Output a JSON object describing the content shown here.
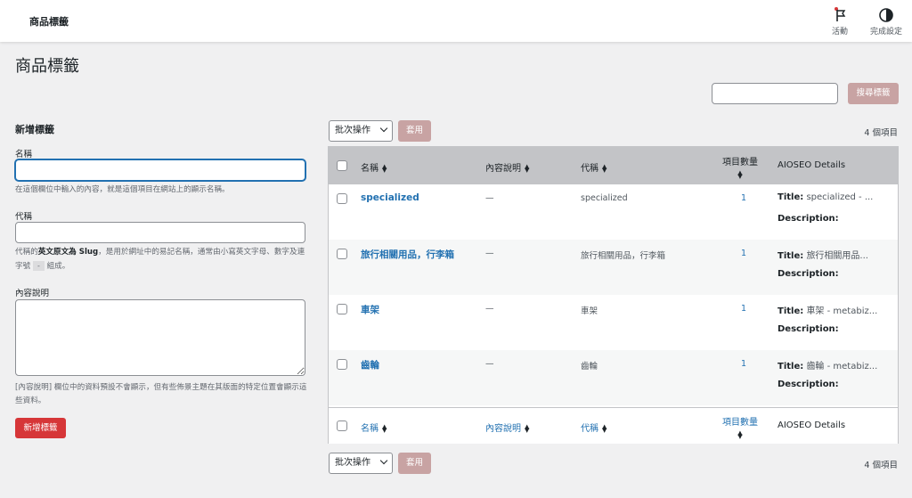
{
  "topbar": {
    "title": "商品標籤",
    "activity_label": "活動",
    "activity_icon": "flag-icon",
    "setup_label": "完成設定",
    "setup_icon": "half-circle-icon"
  },
  "page": {
    "title": "商品標籤"
  },
  "search": {
    "button_label": "搜尋標籤"
  },
  "add_form": {
    "heading": "新增標籤",
    "name_label": "名稱",
    "name_hint": "在這個欄位中輸入的內容，就是這個項目在網站上的顯示名稱。",
    "slug_label": "代稱",
    "slug_hint_1": "代稱的",
    "slug_hint_bold": "英文原文為 Slug",
    "slug_hint_2": "，是用於網址中的易記名稱，通常由小寫英文字母、數字及連字號",
    "slug_hint_code": "-",
    "slug_hint_3": "組成。",
    "desc_label": "內容說明",
    "desc_hint": "[內容說明] 欄位中的資料預設不會顯示，但有些佈景主題在其版面的特定位置會顯示這些資料。",
    "submit_label": "新增標籤"
  },
  "toolbar_top": {
    "bulk_label": "批次操作",
    "apply_label": "套用",
    "count": "4 個項目"
  },
  "toolbar_bottom": {
    "bulk_label": "批次操作",
    "apply_label": "套用",
    "count": "4 個項目"
  },
  "table": {
    "columns": {
      "name": "名稱",
      "description": "內容說明",
      "slug": "代稱",
      "count": "項目數量",
      "seo": "AIOSEO Details"
    },
    "seo_title_label": "Title:",
    "seo_desc_label": "Description:",
    "rows": [
      {
        "name": "specialized",
        "description": "—",
        "slug": "specialized",
        "count": "1",
        "seo_title": "specialized - ..."
      },
      {
        "name": "旅行相關用品，行李箱",
        "description": "—",
        "slug": "旅行相關用品，行李箱",
        "count": "1",
        "seo_title": "旅行相關用品..."
      },
      {
        "name": "車架",
        "description": "—",
        "slug": "車架",
        "count": "1",
        "seo_title": "車架 - metabiz..."
      },
      {
        "name": "齒輪",
        "description": "—",
        "slug": "齒輪",
        "count": "1",
        "seo_title": "齒輪 - metabiz..."
      }
    ]
  },
  "colors": {
    "accent": "#2271b1",
    "danger": "#d63638",
    "disabled_button": "#c8a3a3",
    "header_bg": "#c3c4c7"
  }
}
